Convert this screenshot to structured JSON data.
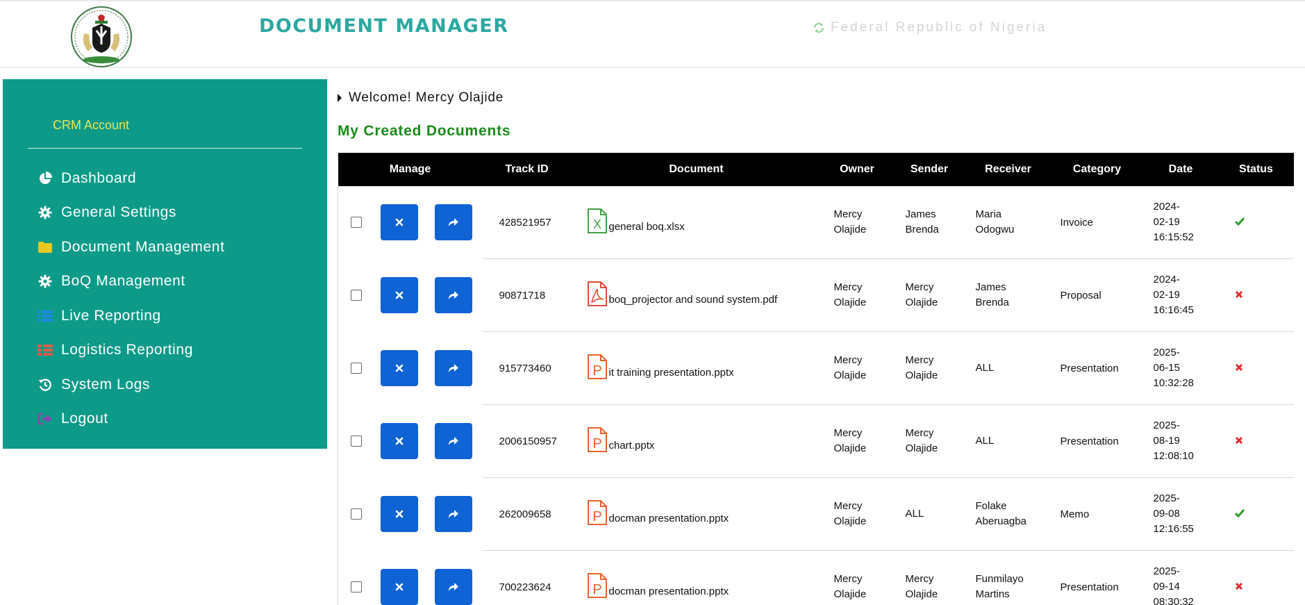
{
  "header": {
    "title": "DOCUMENT MANAGER",
    "country": "Federal Republic of Nigeria"
  },
  "sidebar": {
    "heading": "CRM Account",
    "items": [
      {
        "label": "Dashboard",
        "icon": "pie-chart-icon"
      },
      {
        "label": "General Settings",
        "icon": "gear-icon"
      },
      {
        "label": "Document Management",
        "icon": "folder-icon"
      },
      {
        "label": "BoQ Management",
        "icon": "gear-icon"
      },
      {
        "label": "Live Reporting",
        "icon": "list-icon"
      },
      {
        "label": "Logistics Reporting",
        "icon": "table-icon"
      },
      {
        "label": "System Logs",
        "icon": "history-icon"
      },
      {
        "label": "Logout",
        "icon": "sign-out-icon"
      }
    ]
  },
  "main": {
    "welcome": "Welcome! Mercy Olajide",
    "section_title": "My Created Documents",
    "columns": [
      "Manage",
      "Track ID",
      "Document",
      "Owner",
      "Sender",
      "Receiver",
      "Category",
      "Date",
      "Status"
    ],
    "rows": [
      {
        "track_id": "428521957",
        "document": "general boq.xlsx",
        "file_type": "xlsx",
        "owner": [
          "Mercy",
          "Olajide"
        ],
        "sender": [
          "James",
          "Brenda"
        ],
        "receiver": [
          "Maria",
          "Odogwu"
        ],
        "category": "Invoice",
        "date": [
          "2024-",
          "02-19",
          "16:15:52"
        ],
        "status": "approved"
      },
      {
        "track_id": "90871718",
        "document": "boq_projector and sound system.pdf",
        "file_type": "pdf",
        "owner": [
          "Mercy",
          "Olajide"
        ],
        "sender": [
          "Mercy",
          "Olajide"
        ],
        "receiver": [
          "James",
          "Brenda"
        ],
        "category": "Proposal",
        "date": [
          "2024-",
          "02-19",
          "16:16:45"
        ],
        "status": "rejected"
      },
      {
        "track_id": "915773460",
        "document": "it training presentation.pptx",
        "file_type": "pptx",
        "owner": [
          "Mercy",
          "Olajide"
        ],
        "sender": [
          "Mercy",
          "Olajide"
        ],
        "receiver": [
          "ALL",
          ""
        ],
        "category": "Presentation",
        "date": [
          "2025-",
          "06-15",
          "10:32:28"
        ],
        "status": "rejected"
      },
      {
        "track_id": "2006150957",
        "document": "chart.pptx",
        "file_type": "pptx",
        "owner": [
          "Mercy",
          "Olajide"
        ],
        "sender": [
          "Mercy",
          "Olajide"
        ],
        "receiver": [
          "ALL",
          ""
        ],
        "category": "Presentation",
        "date": [
          "2025-",
          "08-19",
          "12:08:10"
        ],
        "status": "rejected"
      },
      {
        "track_id": "262009658",
        "document": "docman presentation.pptx",
        "file_type": "pptx",
        "owner": [
          "Mercy",
          "Olajide"
        ],
        "sender": [
          "ALL",
          ""
        ],
        "receiver": [
          "Folake",
          "Aberuagba"
        ],
        "category": "Memo",
        "date": [
          "2025-",
          "09-08",
          "12:16:55"
        ],
        "status": "approved"
      },
      {
        "track_id": "700223624",
        "document": "docman presentation.pptx",
        "file_type": "pptx",
        "owner": [
          "Mercy",
          "Olajide"
        ],
        "sender": [
          "Mercy",
          "Olajide"
        ],
        "receiver": [
          "Funmilayo",
          "Martins"
        ],
        "category": "Presentation",
        "date": [
          "2025-",
          "09-14",
          "08:30:32"
        ],
        "status": "rejected"
      }
    ]
  },
  "colors": {
    "sidebar_bg": "#0d9a88",
    "title": "#2ba8a0",
    "section_title": "#1a8a1a",
    "button": "#0f63d4",
    "approved": "#2e9e2e",
    "rejected": "#e02c2c"
  }
}
